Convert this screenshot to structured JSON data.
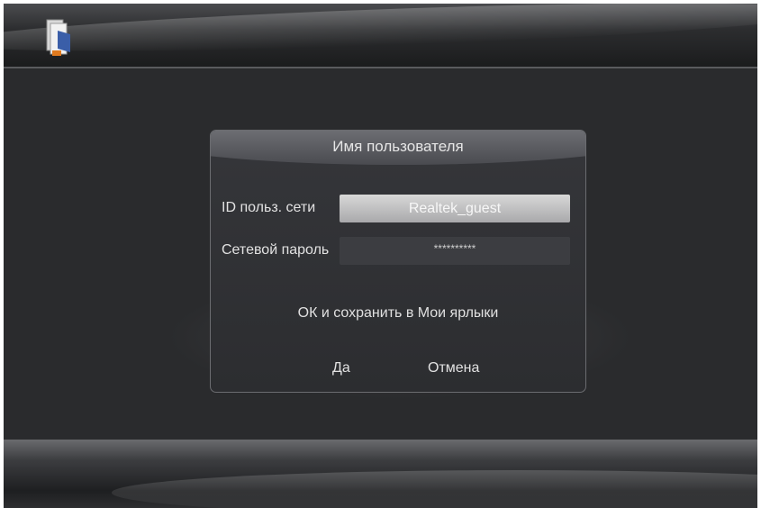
{
  "dialog": {
    "title": "Имя пользователя",
    "network_id_label": "ID польз. сети",
    "network_id_value": "Realtek_guest",
    "password_label": "Сетевой пароль",
    "password_value": "**********",
    "message": "ОК и сохранить в Мои ярлыки",
    "yes_label": "Да",
    "cancel_label": "Отмена"
  },
  "icons": {
    "app_icon": "folder-icon"
  },
  "colors": {
    "background": "#2a2b2d",
    "selected_field": "#c4c4c6",
    "text": "#e2e2e2"
  }
}
